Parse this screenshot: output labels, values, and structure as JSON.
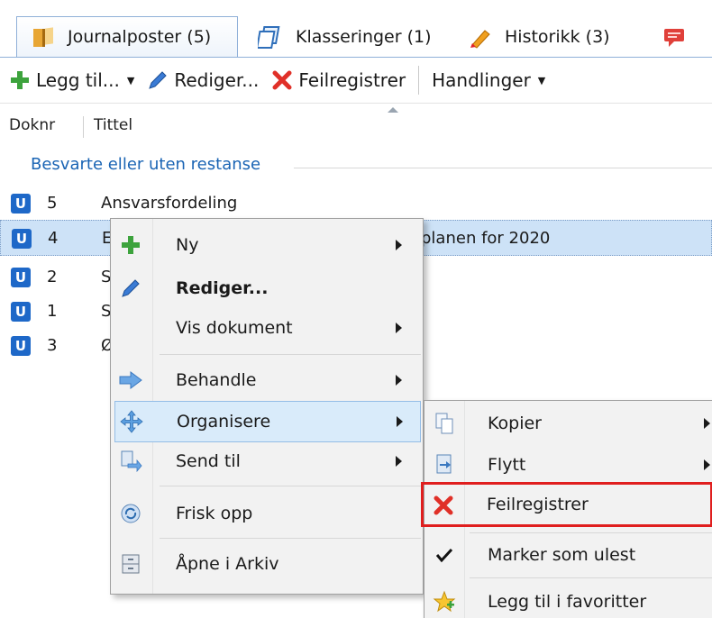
{
  "tabs": [
    {
      "label": "Journalposter (5)",
      "icon": "journal-folder-icon"
    },
    {
      "label": "Klasseringer (1)",
      "icon": "classification-icon"
    },
    {
      "label": "Historikk (3)",
      "icon": "history-pencil-icon"
    },
    {
      "label": "",
      "icon": "comment-icon"
    }
  ],
  "toolbar": {
    "add_label": "Legg til...",
    "edit_label": "Rediger...",
    "void_label": "Feilregistrer",
    "actions_label": "Handlinger"
  },
  "columns": {
    "doknr": "Doknr",
    "tittel": "Tittel"
  },
  "group": {
    "label": "Besvarte eller uten restanse"
  },
  "rows": [
    {
      "badge": "U",
      "num": "5",
      "title": "Ansvarsfordeling"
    },
    {
      "badge": "U",
      "num": "4",
      "title": "E",
      "title_visible_end": "planen for 2020"
    },
    {
      "badge": "U",
      "num": "2",
      "title": "S"
    },
    {
      "badge": "U",
      "num": "1",
      "title": "S"
    },
    {
      "badge": "U",
      "num": "3",
      "title": "Ø"
    }
  ],
  "context_menu": {
    "items": [
      {
        "label": "Ny",
        "submenu": true
      },
      {
        "label": "Rediger...",
        "submenu": false
      },
      {
        "label": "Vis dokument",
        "submenu": true
      },
      {
        "label": "Behandle",
        "submenu": true
      },
      {
        "label": "Organisere",
        "submenu": true
      },
      {
        "label": "Send til",
        "submenu": true
      },
      {
        "label": "Frisk opp",
        "submenu": false
      },
      {
        "label": "Åpne i Arkiv",
        "submenu": false
      }
    ]
  },
  "sub_menu": {
    "items": [
      {
        "label": "Kopier",
        "submenu": true
      },
      {
        "label": "Flytt",
        "submenu": true
      },
      {
        "label": "Feilregistrer",
        "submenu": false
      },
      {
        "label": "Marker som ulest",
        "submenu": false
      },
      {
        "label": "Legg til i favoritter",
        "submenu": false
      }
    ]
  },
  "colors": {
    "accent": "#1e68c8",
    "group_text": "#1a64b4",
    "selection": "#cde2f7",
    "highlight_box": "#e01e1e"
  }
}
